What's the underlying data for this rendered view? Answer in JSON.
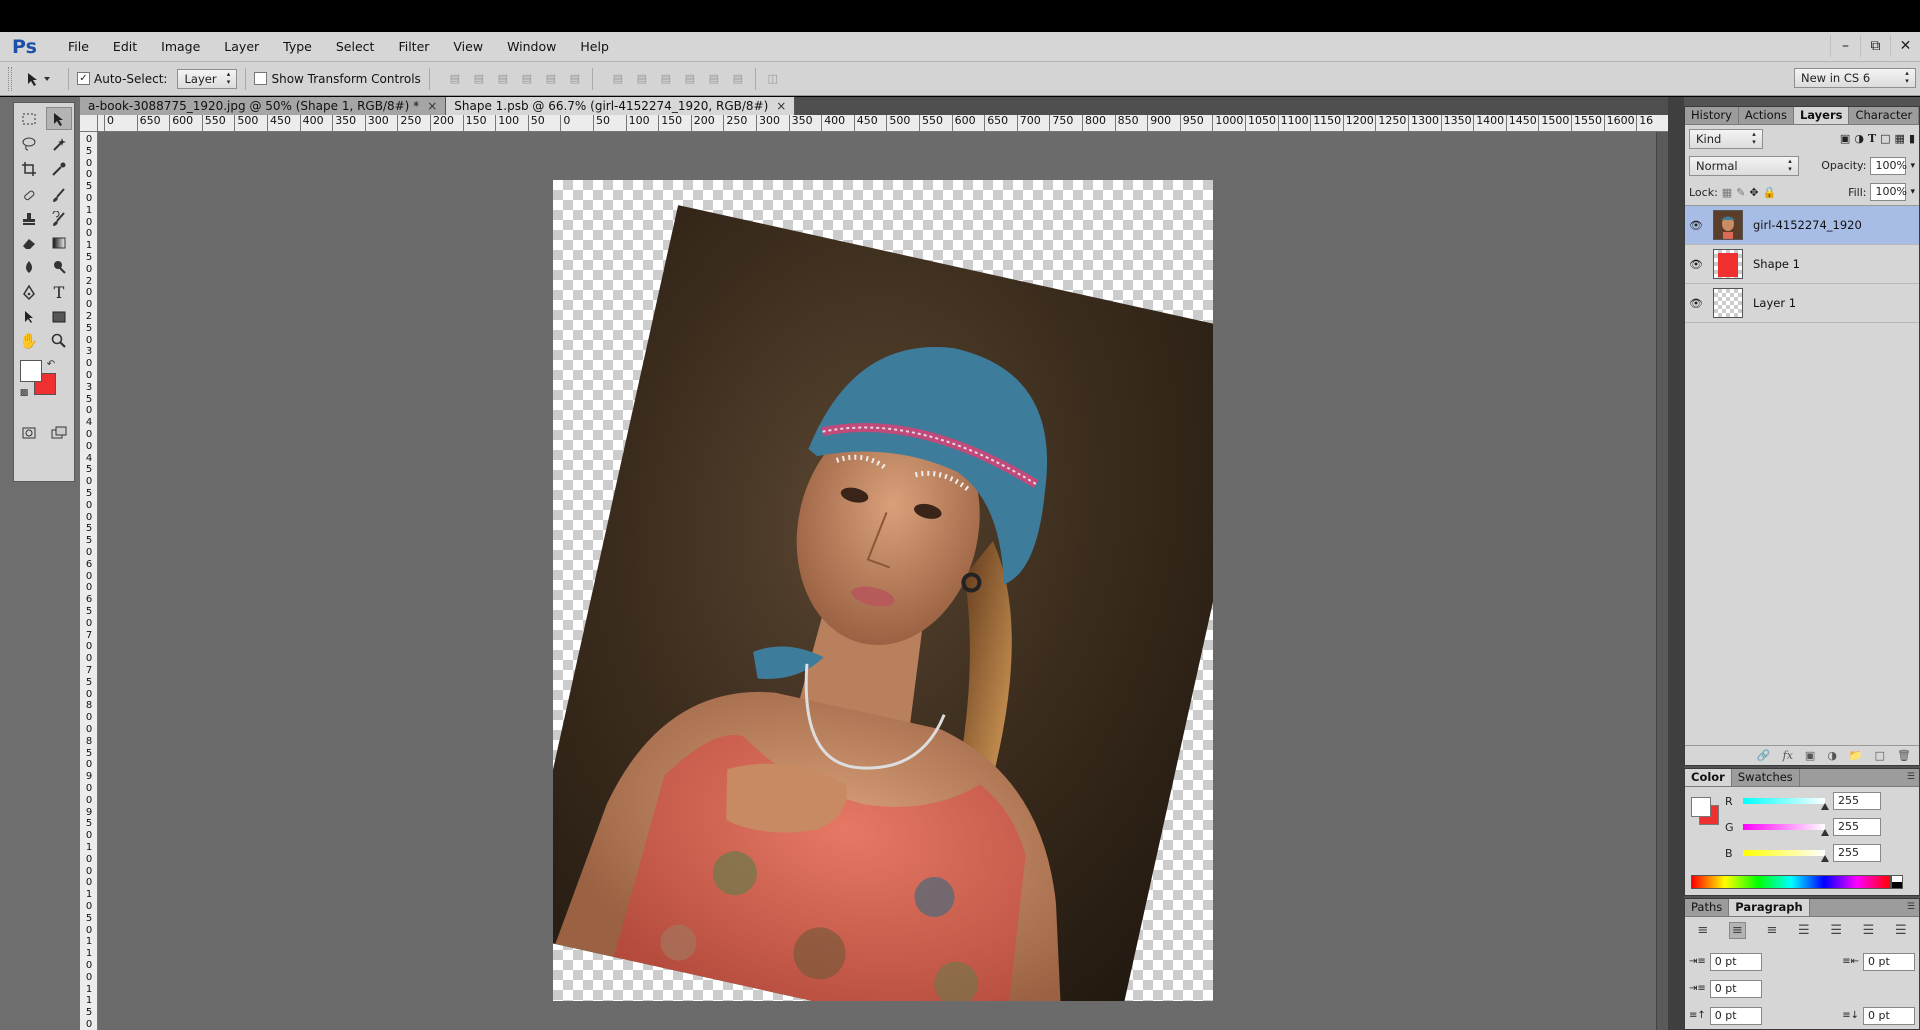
{
  "app": {
    "logo": "Ps"
  },
  "menu": [
    "File",
    "Edit",
    "Image",
    "Layer",
    "Type",
    "Select",
    "Filter",
    "View",
    "Window",
    "Help"
  ],
  "window_controls": {
    "minimize": "–",
    "restore": "⧉",
    "close": "✕"
  },
  "options": {
    "auto_select_label": "Auto-Select:",
    "auto_select_checked": true,
    "auto_select_target": "Layer",
    "show_transform_label": "Show Transform Controls",
    "show_transform_checked": false,
    "workspace": "New in CS 6"
  },
  "doc_tabs": [
    {
      "title": "a-book-3088775_1920.jpg @ 50% (Shape 1, RGB/8#) *",
      "close": "×",
      "active": false
    },
    {
      "title": "Shape 1.psb @ 66.7% (girl-4152274_1920, RGB/8#)",
      "close": "×",
      "active": true
    }
  ],
  "ruler": {
    "h_labels": [
      "0",
      "650",
      "600",
      "550",
      "500",
      "450",
      "400",
      "350",
      "300",
      "250",
      "200",
      "150",
      "100",
      "50",
      "0",
      "50",
      "100",
      "150",
      "200",
      "250",
      "300",
      "350",
      "400",
      "450",
      "500",
      "550",
      "600",
      "650",
      "700",
      "750",
      "800",
      "850",
      "900",
      "950",
      "1000",
      "1050",
      "1100",
      "1150",
      "1200",
      "1250",
      "1300",
      "1350",
      "1400",
      "1450",
      "1500",
      "1550",
      "1600",
      "16"
    ],
    "v_labels": [
      "0",
      "5",
      "0",
      "0",
      "5",
      "0",
      "1",
      "0",
      "0",
      "1",
      "5",
      "0",
      "2",
      "0",
      "0",
      "2",
      "5",
      "0",
      "3",
      "0",
      "0",
      "3",
      "5",
      "0",
      "4",
      "0",
      "0",
      "4",
      "5",
      "0",
      "5",
      "0",
      "0",
      "5",
      "5",
      "0",
      "6",
      "0",
      "0",
      "6",
      "5",
      "0",
      "7",
      "0",
      "0",
      "7",
      "5",
      "0",
      "8",
      "0",
      "0",
      "8",
      "5",
      "0",
      "9",
      "0",
      "0",
      "9",
      "5",
      "0",
      "1",
      "0",
      "0",
      "0",
      "1",
      "0",
      "5",
      "0",
      "1",
      "1",
      "0",
      "0",
      "1",
      "1",
      "5",
      "0"
    ]
  },
  "panels": {
    "top_tabs": [
      "History",
      "Actions",
      "Layers",
      "Character"
    ],
    "top_active": "Layers",
    "kind_filter": "Kind",
    "blend_mode": "Normal",
    "opacity_label": "Opacity:",
    "opacity_value": "100%",
    "lock_label": "Lock:",
    "fill_label": "Fill:",
    "fill_value": "100%",
    "layers": [
      {
        "name": "girl-4152274_1920",
        "selected": true,
        "kind": "photo"
      },
      {
        "name": "Shape 1",
        "selected": false,
        "kind": "shape"
      },
      {
        "name": "Layer 1",
        "selected": false,
        "kind": "empty"
      }
    ],
    "color_tabs": [
      "Color",
      "Swatches"
    ],
    "color_active": "Color",
    "color": {
      "R": "255",
      "G": "255",
      "B": "255"
    },
    "para_tabs": [
      "Paths",
      "Paragraph"
    ],
    "para_active": "Paragraph",
    "para_fields": {
      "indent_left": "0 pt",
      "indent_right": "0 pt",
      "indent_first": "0 pt",
      "space_before": "0 pt",
      "space_after": "0 pt"
    }
  },
  "colors": {
    "foreground": "#ffffff",
    "background": "#ee3030",
    "layer_selected": "#a7bde6",
    "logo": "#1d50a8"
  }
}
